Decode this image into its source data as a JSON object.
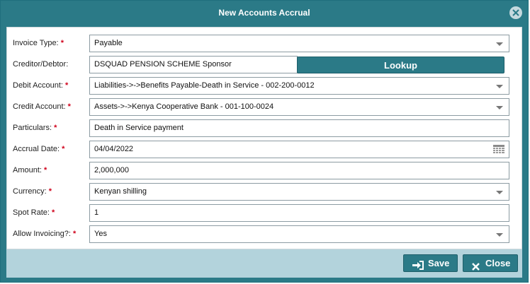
{
  "dialog": {
    "title": "New Accounts Accrual"
  },
  "form": {
    "required_mark": "*",
    "invoice_type": {
      "label": "Invoice Type:",
      "value": "Payable"
    },
    "creditor_debtor": {
      "label": "Creditor/Debtor:",
      "value": "DSQUAD PENSION SCHEME Sponsor",
      "lookup_label": "Lookup"
    },
    "debit_account": {
      "label": "Debit Account:",
      "value": "Liabilities->->Benefits Payable-Death in Service - 002-200-0012"
    },
    "credit_account": {
      "label": "Credit Account:",
      "value": "Assets->->Kenya Cooperative Bank - 001-100-0024"
    },
    "particulars": {
      "label": "Particulars:",
      "value": "Death in Service payment"
    },
    "accrual_date": {
      "label": "Accrual Date:",
      "value": "04/04/2022"
    },
    "amount": {
      "label": "Amount:",
      "value": "2,000,000"
    },
    "currency": {
      "label": "Currency:",
      "value": "Kenyan shilling"
    },
    "spot_rate": {
      "label": "Spot Rate:",
      "value": "1"
    },
    "allow_invoicing": {
      "label": "Allow Invoicing?:",
      "value": "Yes"
    }
  },
  "footer": {
    "save_label": "Save",
    "close_label": "Close"
  },
  "icons": {
    "dialog_close": "close-circle-icon",
    "dropdown": "chevron-down-icon",
    "calendar": "calendar-icon",
    "save": "sign-in-icon",
    "close": "x-icon"
  },
  "colors": {
    "header": "#2b7a87",
    "footer": "#b3d3dc",
    "required": "#d0021b",
    "button": "#2b7a87"
  }
}
